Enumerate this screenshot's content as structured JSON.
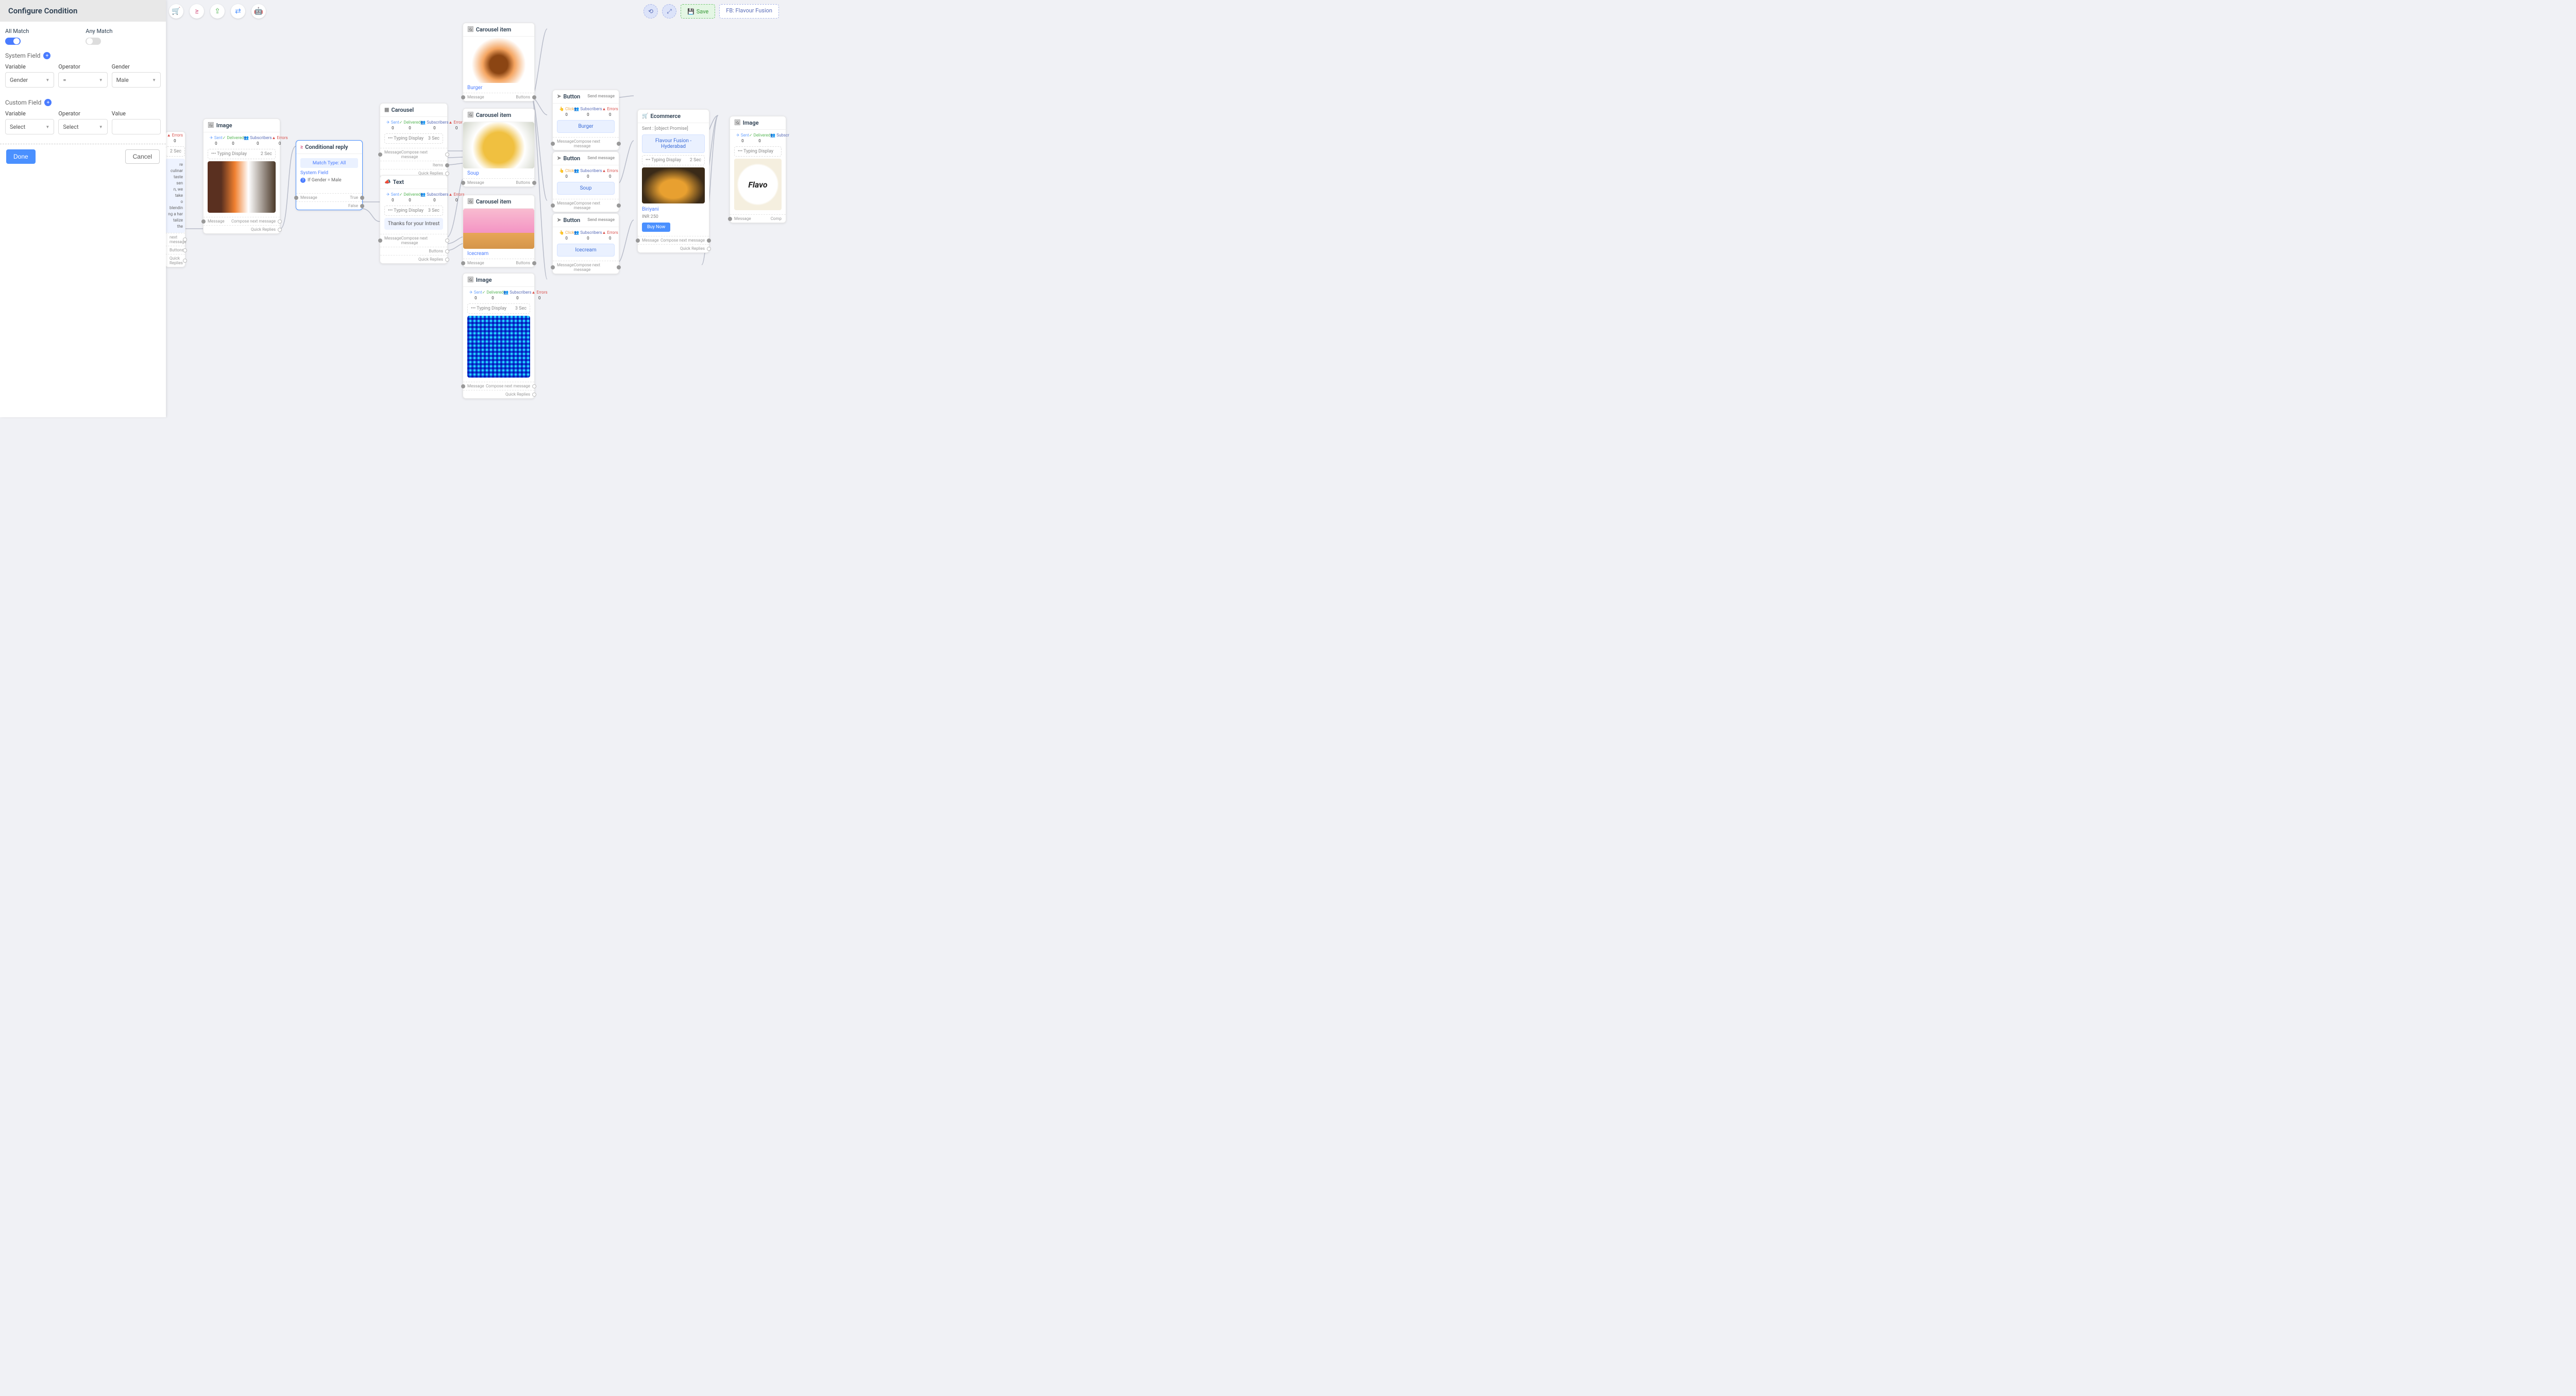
{
  "panel": {
    "title": "Configure Condition",
    "all_match": "All Match",
    "any_match": "Any Match",
    "system_field": "System Field",
    "custom_field": "Custom Field",
    "variable_lbl": "Variable",
    "operator_lbl": "Operator",
    "gender_lbl": "Gender",
    "value_lbl": "Value",
    "sf_variable": "Gender",
    "sf_operator": "=",
    "sf_value": "Male",
    "cf_variable": "Select",
    "cf_operator": "Select",
    "done": "Done",
    "cancel": "Cancel"
  },
  "topright": {
    "save": "Save",
    "fb": "FB: Flavour Fusion"
  },
  "stats_labels": {
    "sent": "Sent",
    "delivered": "Delivered",
    "subscribers": "Subscribers",
    "errors": "Errors",
    "click": "Click"
  },
  "conn": {
    "message": "Message",
    "compose": "Compose next message",
    "quick": "Quick Replies",
    "items": "Items",
    "buttons": "Buttons",
    "true": "True",
    "false": "False",
    "next": "next message"
  },
  "typing": {
    "label": "Typing Display",
    "s2": "2 Sec",
    "s3": "3 Sec"
  },
  "text_peek": {
    "errors": "Errors",
    "zero": "0",
    "l1": "re culinar",
    "l2": "taste sen",
    "l3": "n, we take",
    "l4": "o blendin",
    "l5": "ng a har",
    "l6": "talize the"
  },
  "node_image": {
    "title": "Image",
    "sent": "0",
    "del": "0",
    "sub": "0",
    "err": "0"
  },
  "node_cond": {
    "title": "Conditional reply",
    "match": "Match Type: All",
    "sys": "System Field",
    "rule": "If Gender = Male"
  },
  "node_carousel": {
    "title": "Carousel",
    "sent": "0",
    "del": "0",
    "sub": "0",
    "err": "0"
  },
  "node_text": {
    "title": "Text",
    "sent": "0",
    "del": "0",
    "sub": "0",
    "err": "0",
    "msg": "Thanks for your Intrest"
  },
  "ci": {
    "title": "Carousel item",
    "burger": "Burger",
    "soup": "Soup",
    "ice": "Icecream"
  },
  "btn": {
    "title": "Button",
    "send": "Send message",
    "burger": "Burger",
    "soup": "Soup",
    "ice": "Icecream",
    "click": "0",
    "sub": "0",
    "err": "0"
  },
  "node_qr": {
    "title": "Image",
    "sent": "0",
    "del": "0",
    "sub": "0",
    "err": "0"
  },
  "ecom": {
    "title": "Ecommerce",
    "sent": "Sent : [object Promise]",
    "ff": "Flavour Fusion - Hyderabad",
    "item": "Biriyani",
    "price": "INR 250",
    "buy": "Buy Now"
  },
  "node_img2": {
    "title": "Image",
    "sent": "Sent",
    "del": "Delivered",
    "sub": "Subscr",
    "zero": "0"
  }
}
